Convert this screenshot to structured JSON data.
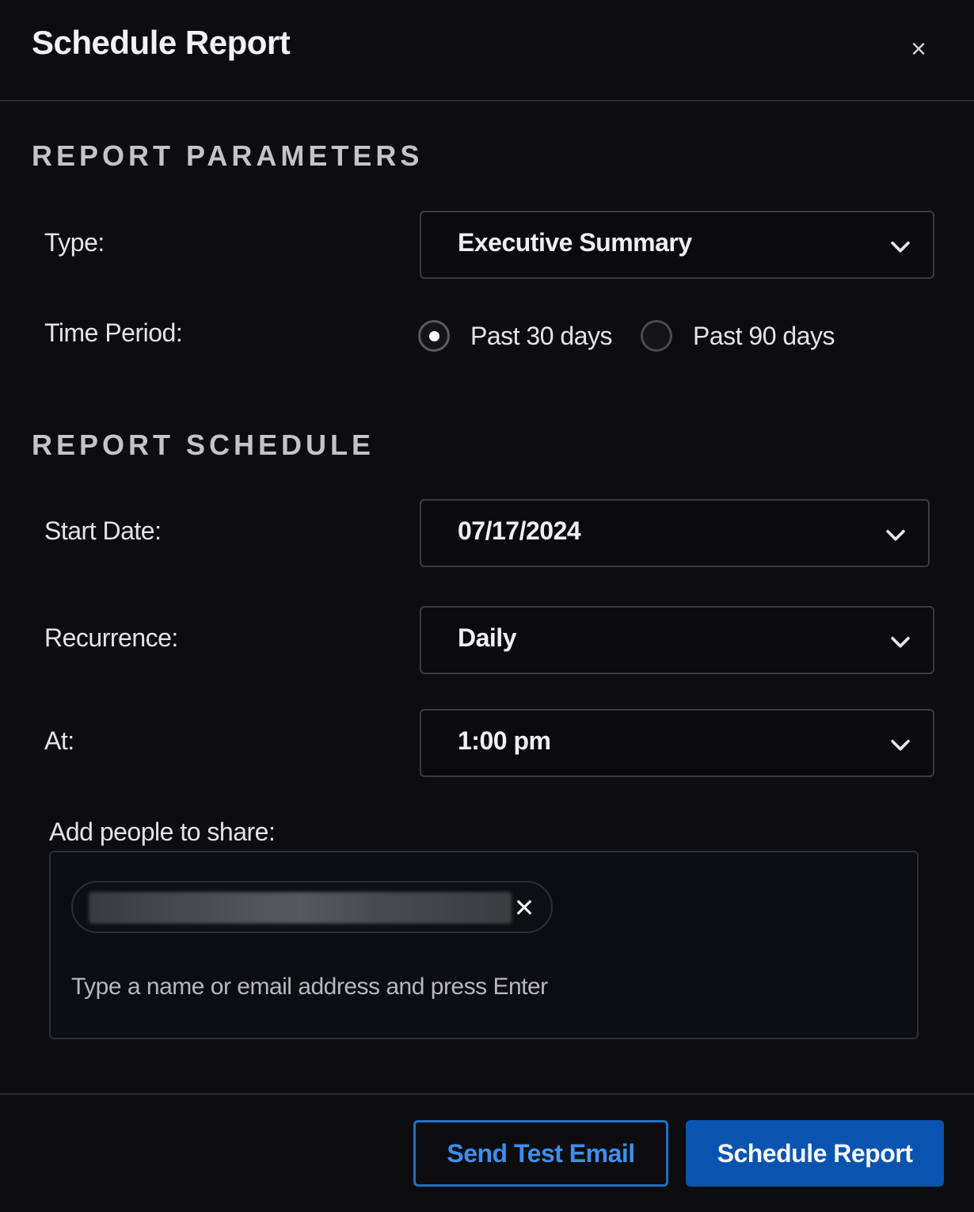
{
  "dialog": {
    "title": "Schedule Report",
    "close_label": "×"
  },
  "report_parameters": {
    "heading": "REPORT PARAMETERS",
    "type": {
      "label": "Type:",
      "value": "Executive Summary"
    },
    "time_period": {
      "label": "Time Period:",
      "options": [
        {
          "label": "Past 30 days",
          "checked": true
        },
        {
          "label": "Past 90 days",
          "checked": false
        }
      ]
    }
  },
  "report_schedule": {
    "heading": "REPORT SCHEDULE",
    "start_date": {
      "label": "Start Date:",
      "value": "07/17/2024"
    },
    "recurrence": {
      "label": "Recurrence:",
      "value": "Daily"
    },
    "at": {
      "label": "At:",
      "value": "1:00 pm"
    }
  },
  "share": {
    "label": "Add people to share:",
    "chip_remove_label": "✕",
    "input_value": "",
    "placeholder": "Type a name or email address and press Enter"
  },
  "footer": {
    "send_test_label": "Send Test Email",
    "schedule_label": "Schedule Report"
  },
  "colors": {
    "background": "#0d0d0f",
    "accent": "#0a54b0",
    "accent_outline": "#1f6fd1",
    "border": "#3a3b40"
  },
  "icons": {
    "close": "close-icon",
    "chevron": "chevron-down-icon",
    "chip_remove": "remove-icon"
  }
}
